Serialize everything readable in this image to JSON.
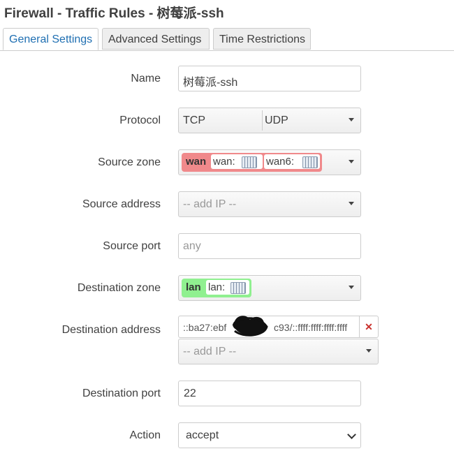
{
  "page": {
    "title": "Firewall - Traffic Rules - 树莓派-ssh"
  },
  "tabs": [
    {
      "label": "General Settings",
      "active": true
    },
    {
      "label": "Advanced Settings",
      "active": false
    },
    {
      "label": "Time Restrictions",
      "active": false
    }
  ],
  "form": {
    "name": {
      "label": "Name",
      "value": "树莓派-ssh"
    },
    "protocol": {
      "label": "Protocol",
      "values": [
        "TCP",
        "UDP"
      ]
    },
    "source_zone": {
      "label": "Source zone",
      "zone": "wan",
      "interfaces": [
        "wan:",
        "wan6:"
      ],
      "color": "#f0898b"
    },
    "source_address": {
      "label": "Source address",
      "placeholder": "-- add IP --"
    },
    "source_port": {
      "label": "Source port",
      "placeholder": "any"
    },
    "destination_zone": {
      "label": "Destination zone",
      "zone": "lan",
      "interfaces": [
        "lan:"
      ],
      "color": "#90f090"
    },
    "destination_address": {
      "label": "Destination address",
      "chip_text": "::ba27:ebf",
      "chip_text_suffix": "c93/::ffff:ffff:ffff:ffff",
      "remove_symbol": "✕",
      "placeholder": "-- add IP --"
    },
    "destination_port": {
      "label": "Destination port",
      "value": "22"
    },
    "action": {
      "label": "Action",
      "value": "accept"
    }
  },
  "colors": {
    "accent": "#1f6fb2",
    "remove": "#c9302c"
  }
}
